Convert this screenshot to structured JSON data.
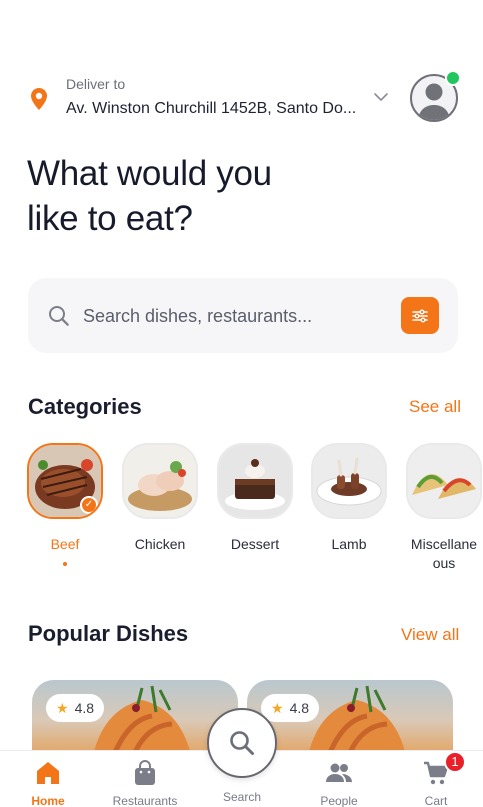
{
  "deliver": {
    "label": "Deliver to",
    "address": "Av. Winston Churchill 1452B, Santo Do...",
    "pin_icon": "location-pin-icon",
    "chevron_icon": "chevron-down-icon"
  },
  "profile": {
    "avatar_icon": "user-avatar-icon",
    "status_color": "#23c55e"
  },
  "headline": {
    "line1": "What would you",
    "line2": "like to eat?"
  },
  "search": {
    "placeholder": "Search dishes, restaurants...",
    "icon": "search-icon",
    "filter_icon": "filter-sliders-icon"
  },
  "categories": {
    "title": "Categories",
    "see_all": "See all",
    "items": [
      {
        "label": "Beef",
        "active": true
      },
      {
        "label": "Chicken",
        "active": false
      },
      {
        "label": "Dessert",
        "active": false
      },
      {
        "label": "Lamb",
        "active": false
      },
      {
        "label": "Miscellane\nous",
        "active": false
      }
    ]
  },
  "popular": {
    "title": "Popular Dishes",
    "view_all": "View all",
    "dishes": [
      {
        "rating": "4.8"
      },
      {
        "rating": "4.8"
      }
    ]
  },
  "nav": {
    "items": [
      {
        "label": "Home",
        "icon": "home-icon",
        "active": true
      },
      {
        "label": "Restaurants",
        "icon": "shopping-bag-icon",
        "active": false
      },
      {
        "label": "Search",
        "icon": "search-icon",
        "active": false
      },
      {
        "label": "People",
        "icon": "people-icon",
        "active": false
      },
      {
        "label": "Cart",
        "icon": "cart-icon",
        "active": false
      }
    ],
    "cart_count": "1"
  },
  "colors": {
    "accent": "#f47518",
    "badge": "#e8202a",
    "text": "#1f2233"
  }
}
